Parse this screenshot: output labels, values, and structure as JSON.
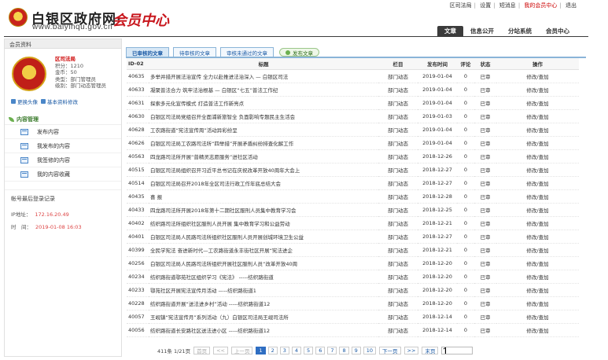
{
  "top_links": {
    "items": [
      "区司法局",
      "设置",
      "短消息",
      "我的会员中心",
      "退出"
    ],
    "highlight_index": 3
  },
  "header": {
    "site_title": "白银区政府网",
    "dot": "·",
    "center_title": "会员中心",
    "url": "www.baiyinqu.gov.cn"
  },
  "nav": [
    "文章",
    "信息公开",
    "分站系统",
    "会员中心"
  ],
  "sidebar": {
    "header": "会员资料",
    "profile": {
      "username": "区司法局",
      "points": "积分：1210",
      "coins": "金币：50",
      "type": "类型：部门管理员",
      "level": "级别：部门动态管理员"
    },
    "actions": [
      "更换头像",
      "基本资料修改"
    ],
    "content_title": "内容管理",
    "menu": [
      "发布内容",
      "我发布的内容",
      "我签修的内容",
      "我的内容收藏"
    ],
    "login_title": "帐号最后登录记录",
    "login_ip_label": "IP地址：",
    "login_ip": "172.16.20.49",
    "login_time_label": "时　间：",
    "login_time": "2019-01-08 16:03"
  },
  "tabs": [
    "已审核的文章",
    "待审核的文章",
    "审核未通过的文章",
    "发布文章"
  ],
  "table": {
    "headers": [
      "ID-02",
      "标题",
      "栏目",
      "发布时间",
      "评论",
      "状态",
      "操作"
    ],
    "rows": [
      [
        "40635",
        "多举并措开展法治宣传 全力以赴推进法治深入 — 白银区司法",
        "部门动态",
        "2019-01-04",
        "0",
        "已审",
        "修改/查加"
      ],
      [
        "40633",
        "凝聚普法合力 筑牢法治根基 — 白银区“七五”普法工作纪",
        "部门动态",
        "2019-01-04",
        "0",
        "已审",
        "修改/查加"
      ],
      [
        "40631",
        "探索多元化宣传模式 打造普法工作新亮点",
        "部门动态",
        "2019-01-04",
        "0",
        "已审",
        "修改/查加"
      ],
      [
        "40630",
        "白银区司法局党组召开全面浦新旅智全 负面影响专题民主生活会",
        "部门动态",
        "2019-01-03",
        "0",
        "已审",
        "修改/查加"
      ],
      [
        "40628",
        "工农路街道“宪法宣传周”活动异彩纷呈",
        "部门动态",
        "2019-01-04",
        "0",
        "已审",
        "修改/查加"
      ],
      [
        "40626",
        "白银区司法局工农路司法所“四举措”开展矛盾纠纷排查化解工作",
        "部门动态",
        "2019-01-04",
        "0",
        "已审",
        "修改/查加"
      ],
      [
        "40563",
        "四龙路司法所开展“普精灵志愿服务”进社区活动",
        "部门动态",
        "2018-12-26",
        "0",
        "已审",
        "修改/查加"
      ],
      [
        "40515",
        "白银区司法局组织召开习近平总书记在庆祝改革开放40周年大会上",
        "部门动态",
        "2018-12-27",
        "0",
        "已审",
        "修改/查加"
      ],
      [
        "40514",
        "白银区司法局召开2018年全区司法行政工作年底总结大会",
        "部门动态",
        "2018-12-27",
        "0",
        "已审",
        "修改/查加"
      ],
      [
        "40435",
        "喜 报",
        "部门动态",
        "2018-12-28",
        "0",
        "已审",
        "修改/查加"
      ],
      [
        "40433",
        "四龙路司法所开展2018年第十二期社区服刑人员集中教育学习会",
        "部门动态",
        "2018-12-25",
        "0",
        "已审",
        "修改/查加"
      ],
      [
        "40402",
        "纺织路司法所组织社区服刑人员开展 集中教育学习和公益劳动",
        "部门动态",
        "2018-12-21",
        "0",
        "已审",
        "修改/查加"
      ],
      [
        "40401",
        "白银区司法局人民路司法所组织社区服刑人员开展创城环境卫生公益",
        "部门动态",
        "2018-12-27",
        "0",
        "已审",
        "修改/查加"
      ],
      [
        "40399",
        "全民学宪法 奋进新时代—工农路街道永丰街社区开展“宪法进企",
        "部门动态",
        "2018-12-21",
        "0",
        "已审",
        "修改/查加"
      ],
      [
        "40256",
        "白银区司法局人民路司法所组织开展社区服刑人员“改革开放40周",
        "部门动态",
        "2018-12-20",
        "0",
        "已审",
        "修改/查加"
      ],
      [
        "40234",
        "纺织路街道鄂苑社区组织学习《宪法》 -----纺织路街道",
        "部门动态",
        "2018-12-20",
        "0",
        "已审",
        "修改/查加"
      ],
      [
        "40233",
        "鄂苑社区开展宪法宣传月活动 -----纺织路街道1",
        "部门动态",
        "2018-12-20",
        "0",
        "已审",
        "修改/查加"
      ],
      [
        "40228",
        "纺织路街道开展“送法进乡村”活动 -----纺织路街道12",
        "部门动态",
        "2018-12-20",
        "0",
        "已审",
        "修改/查加"
      ],
      [
        "40057",
        "王岘镇“宪法宣传月”系列活动（九）白银区司法局王岘司法所",
        "部门动态",
        "2018-12-14",
        "0",
        "已审",
        "修改/查加"
      ],
      [
        "40056",
        "纺织路街道长安路社区送法进小区 -----纺织路街道12",
        "部门动态",
        "2018-12-14",
        "0",
        "已审",
        "修改/查加"
      ]
    ]
  },
  "pager": {
    "summary": "411条 1/21页",
    "first": "首页",
    "prev_arrows": "<<",
    "prev": "上一页",
    "pages": [
      "1",
      "2",
      "3",
      "4",
      "5",
      "6",
      "7",
      "8",
      "9",
      "10"
    ],
    "current": "1",
    "next": "下一页",
    "next_arrows": ">>",
    "last": "末页",
    "goto_value": "1"
  }
}
